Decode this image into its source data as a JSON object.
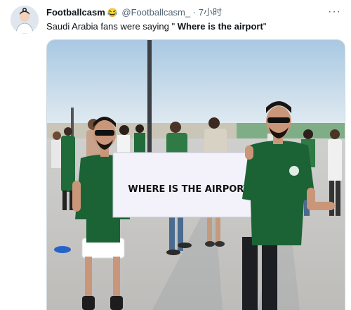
{
  "tweet": {
    "display_name": "Footballcasm",
    "emoji": "😂",
    "handle": "@Footballcasm_",
    "separator": "·",
    "time": "7小时",
    "more_label": "···",
    "text_before": "Saudi Arabia fans were saying \" ",
    "text_bold": "Where is the airport",
    "text_after": "\""
  },
  "photo": {
    "sign_text": "WHERE IS THE AIRPORT"
  },
  "colors": {
    "jersey_green": "#1f6b3a",
    "sky": "#c6dcec",
    "plaza": "#d6d4d0",
    "text": "#0f1419",
    "secondary": "#536471"
  }
}
